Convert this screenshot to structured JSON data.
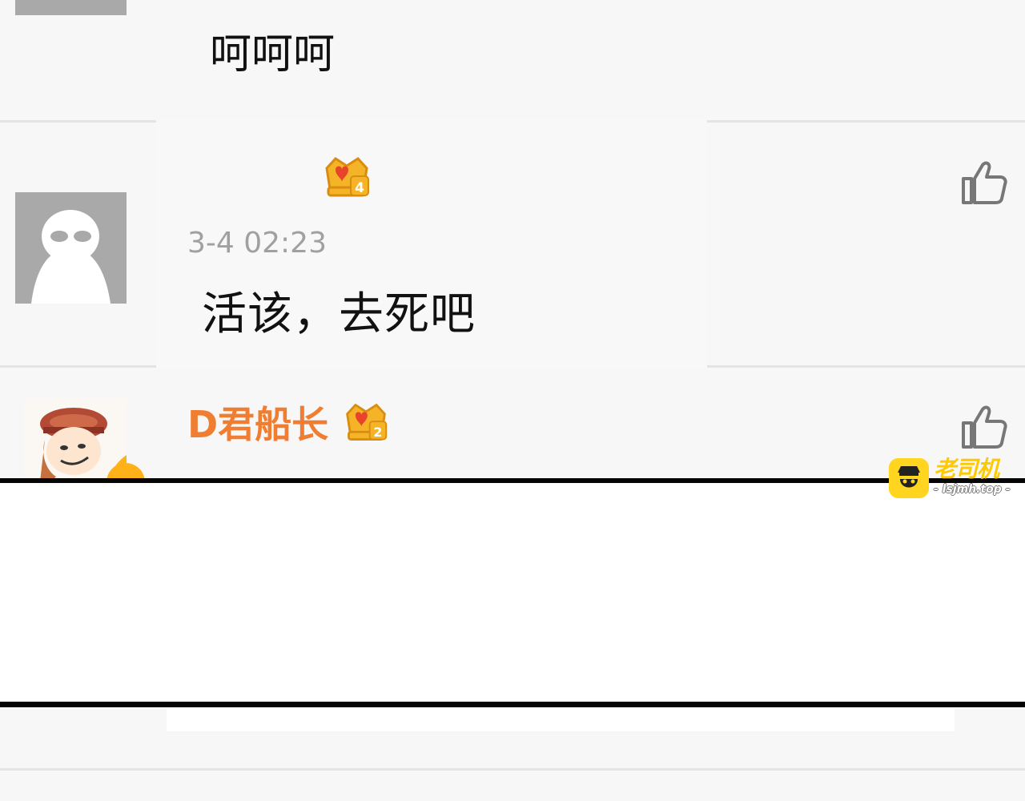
{
  "comments": [
    {
      "username": "",
      "time": "",
      "text": "呵呵呵"
    },
    {
      "username": "",
      "badge_level": "4",
      "time": "3-4 02:23",
      "text": "活该，去死吧",
      "like_icon": "thumbs-up-icon"
    },
    {
      "username": "D君船长",
      "badge_level": "2",
      "like_icon": "thumbs-up-icon"
    }
  ],
  "watermark": {
    "title": "老司机",
    "url": "- lsjmh.top -"
  },
  "colors": {
    "background": "#f7f7f7",
    "divider": "#e4e4e4",
    "username_orange": "#f07e32",
    "timestamp_gray": "#a0a0a0",
    "avatar_gray": "#a9a9a9",
    "crown_gold": "#f5b428",
    "crown_red": "#e8432b",
    "panel_border": "#050505",
    "watermark_yellow": "#ffd51f"
  }
}
